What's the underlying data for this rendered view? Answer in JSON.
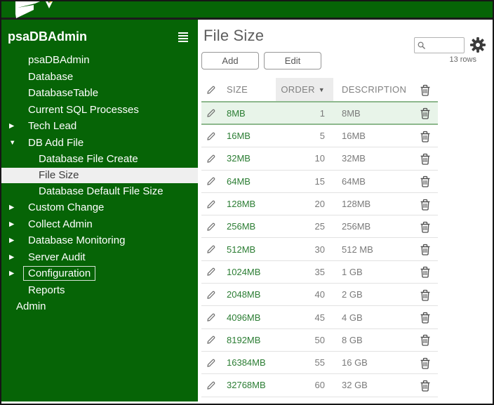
{
  "topbar": {
    "logo": "brand-logo"
  },
  "sidebar": {
    "title": "psaDBAdmin",
    "items": [
      {
        "label": "psaDBAdmin",
        "level": 1
      },
      {
        "label": "Database",
        "level": 1
      },
      {
        "label": "DatabaseTable",
        "level": 1
      },
      {
        "label": "Current SQL Processes",
        "level": 1
      },
      {
        "label": "Tech Lead",
        "level": 1,
        "arrow": "collapsed"
      },
      {
        "label": "DB Add File",
        "level": 1,
        "arrow": "expanded"
      },
      {
        "label": "Database File Create",
        "level": 2
      },
      {
        "label": "File Size",
        "level": 2,
        "selected": true
      },
      {
        "label": "Database Default File Size",
        "level": 2
      },
      {
        "label": "Custom Change",
        "level": 1,
        "arrow": "collapsed"
      },
      {
        "label": "Collect Admin",
        "level": 1,
        "arrow": "collapsed"
      },
      {
        "label": "Database Monitoring",
        "level": 1,
        "arrow": "collapsed"
      },
      {
        "label": "Server Audit",
        "level": 1,
        "arrow": "collapsed"
      },
      {
        "label": "Configuration",
        "level": 1,
        "arrow": "collapsed",
        "focused": true
      },
      {
        "label": "Reports",
        "level": 1
      },
      {
        "label": "Admin",
        "level": 0
      }
    ]
  },
  "main": {
    "title": "File Size",
    "buttons": {
      "add": "Add",
      "edit": "Edit"
    },
    "search": {
      "placeholder": "",
      "value": ""
    },
    "rows_count": "13 rows",
    "table": {
      "headers": {
        "size": "SIZE",
        "order": "ORDER",
        "description": "DESCRIPTION"
      },
      "sort_indicator": "▼",
      "sorted_by": "ORDER",
      "rows": [
        {
          "size": "8MB",
          "order": "1",
          "description": "8MB",
          "selected": true
        },
        {
          "size": "16MB",
          "order": "5",
          "description": "16MB"
        },
        {
          "size": "32MB",
          "order": "10",
          "description": "32MB"
        },
        {
          "size": "64MB",
          "order": "15",
          "description": "64MB"
        },
        {
          "size": "128MB",
          "order": "20",
          "description": "128MB"
        },
        {
          "size": "256MB",
          "order": "25",
          "description": "256MB"
        },
        {
          "size": "512MB",
          "order": "30",
          "description": "512 MB"
        },
        {
          "size": "1024MB",
          "order": "35",
          "description": "1 GB"
        },
        {
          "size": "2048MB",
          "order": "40",
          "description": "2 GB"
        },
        {
          "size": "4096MB",
          "order": "45",
          "description": "4 GB"
        },
        {
          "size": "8192MB",
          "order": "50",
          "description": "8 GB"
        },
        {
          "size": "16384MB",
          "order": "55",
          "description": "16 GB"
        },
        {
          "size": "32768MB",
          "order": "60",
          "description": "32 GB"
        }
      ]
    }
  },
  "colors": {
    "brand_green": "#066406",
    "selected_row_bg": "#e8f4e9",
    "selected_row_border": "#8db88d",
    "link_green": "#2b7d33",
    "selected_nav_bg": "#efefef"
  }
}
